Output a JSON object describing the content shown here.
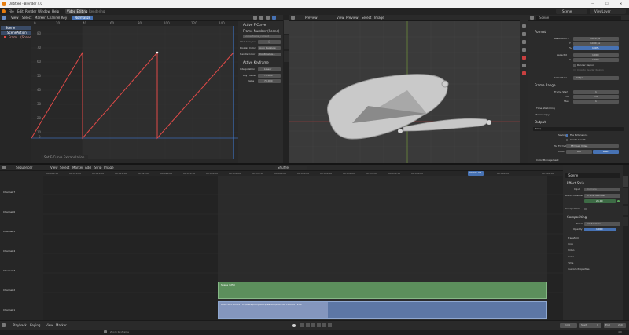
{
  "titlebar": {
    "title": "Untitled - Blender 4.0",
    "min": "—",
    "max": "☐",
    "close": "✕"
  },
  "menubar": {
    "items": [
      "File",
      "Edit",
      "Render",
      "Window",
      "Help"
    ],
    "workspaces": [
      {
        "label": "Video Editing",
        "active": true
      },
      {
        "label": "Rendering",
        "active": false
      }
    ],
    "scene_label": "Scene",
    "view_layer_label": "ViewLayer"
  },
  "graph_editor": {
    "header": [
      "View",
      "Select",
      "Marker",
      "Channel",
      "Key",
      "Normalize"
    ],
    "ruler": [
      "0",
      "20",
      "40",
      "60",
      "80",
      "100",
      "120",
      "140"
    ],
    "y_labels": [
      "80",
      "70",
      "60",
      "50",
      "40",
      "30",
      "20",
      "10",
      "0"
    ],
    "status": "Set F-Curve Extrapolation",
    "channels": [
      {
        "label": "Scene"
      },
      {
        "label": "SceneAction"
      },
      {
        "label": "Fram... (Scene)"
      }
    ],
    "side_tabs": [
      "F-Curve",
      "Modifiers",
      "View"
    ],
    "sidebar": {
      "active_fcurve": "Active F-Curve",
      "fcurve_name": "Frame Number (Scene)",
      "rna_path": "Frame Number",
      "rna_value": "scene.frame_current",
      "array_index_label": "RNA Array Ind...",
      "array_index": "0",
      "display_color_label": "Display Color",
      "display_color": "Auto Rainbow",
      "handle_color_label": "Handle Color",
      "handle_color": "Continuous...",
      "active_keyframe": "Active Keyframe",
      "interp_label": "Interpolation",
      "interp": "Linear",
      "key_frame_label": "Key Frame",
      "key_frame": "74.000",
      "value_label": "Value",
      "value": "74.000"
    }
  },
  "preview": {
    "header": [
      "View",
      "Preview",
      "Select",
      "Image"
    ],
    "mode": "Preview"
  },
  "properties": {
    "search_placeholder": "Scene",
    "format_title": "Format",
    "resolution_x_label": "Resolution X",
    "resolution_x": "1920 px",
    "resolution_y_label": "Y",
    "resolution_y": "1080 px",
    "percent_label": "%",
    "percent": "100%",
    "aspect_x_label": "Aspect X",
    "aspect_x": "1.000",
    "aspect_y_label": "Y",
    "aspect_y": "1.000",
    "render_region": "Render Region",
    "crop": "Crop to Render Region",
    "frame_rate_label": "Frame Rate",
    "frame_rate": "24 fps",
    "frame_range_title": "Frame Range",
    "frame_start_label": "Frame Start",
    "frame_start": "1",
    "end_label": "End",
    "end": "250",
    "step_label": "Step",
    "step": "1",
    "time_stretch": "Time Stretching",
    "stereo": "Stereoscopy",
    "output_title": "Output",
    "output_path": "/tmp\\",
    "saving_label": "Saving",
    "file_ext": "File Extensions",
    "cache": "Cache Result",
    "file_format_label": "File Format",
    "file_format": "FFmpeg Video",
    "color_label": "Color",
    "color_bw": "BW",
    "color_rgb": "RGB",
    "color_mgmt": "Color Management"
  },
  "sequencer": {
    "header": [
      "View",
      "Select",
      "Marker",
      "Add",
      "Strip",
      "Image"
    ],
    "editor_label": "Sequencer",
    "shuffle": "Shuffle",
    "ruler": [
      "00:00+16",
      "00:01+00",
      "00:01+08",
      "00:01+16",
      "00:02+00",
      "00:02+08",
      "00:02+16",
      "00:03+00",
      "00:03+08",
      "00:03+16",
      "00:04+00",
      "00:04+08",
      "00:04+16",
      "00:05+00",
      "00:05+08",
      "00:05+16",
      "00:06+00",
      "00:06+08",
      "00:06+16"
    ],
    "current_time": "00:07+08",
    "channels": [
      "Channel 7",
      "Channel 6",
      "Channel 5",
      "Channel 4",
      "Channel 3",
      "Channel 2",
      "Channel 1"
    ],
    "strip_scene": "Scene | 250",
    "strip_movie": "0001-0075.mp4 | C:\\Users\\Computer\\Desktop\\0001-0075.mp4 | 250"
  },
  "strip_props": {
    "name": "Scene",
    "effect_strip": "Effect Strip",
    "input_label": "Input",
    "input": "Camera",
    "source_label": "Source Channel",
    "source": "Frame Number",
    "source_value": "25.00",
    "interp_label": "Interpolation",
    "interp": "",
    "compositing": "Compositing",
    "blend_label": "Blend",
    "blend": "Alpha Over",
    "opacity_label": "Opacity",
    "opacity": "1.000",
    "sections": [
      "Transform",
      "Crop",
      "Video",
      "Color",
      "Time",
      "Custom Properties"
    ],
    "tabs": [
      "Strip",
      "Modifiers",
      "Tool",
      "View"
    ]
  },
  "timeline": {
    "items": [
      "Playback",
      "Keying",
      "View",
      "Marker"
    ],
    "frame": "174",
    "start_label": "Start",
    "start": "1",
    "end_label": "End",
    "end": "250"
  },
  "statusbar": {
    "hint": "Zoom Keyframe",
    "version": "4.0"
  },
  "colors": {
    "accent": "#4772b3",
    "curve": "#e04a48",
    "strip_scene": "#5c8f5c",
    "strip_movie": "#6f82a8",
    "playhead": "#3c79d6"
  }
}
